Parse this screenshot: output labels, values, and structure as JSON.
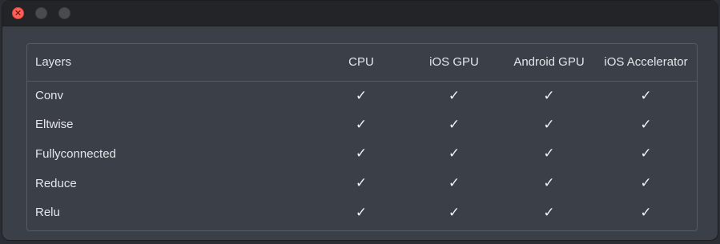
{
  "window": {
    "controls": {
      "close_glyph": "✕",
      "close_icon": "close-icon",
      "minimize_icon": "minimize-icon",
      "maximize_icon": "maximize-icon"
    }
  },
  "table": {
    "headers": [
      "Layers",
      "CPU",
      "iOS GPU",
      "Android GPU",
      "iOS Accelerator"
    ],
    "check_glyph": "✓",
    "rows": [
      {
        "layer": "Conv",
        "cells": [
          "✓",
          "✓",
          "✓",
          "✓"
        ]
      },
      {
        "layer": "Eltwise",
        "cells": [
          "✓",
          "✓",
          "✓",
          "✓"
        ]
      },
      {
        "layer": "Fullyconnected",
        "cells": [
          "✓",
          "✓",
          "✓",
          "✓"
        ]
      },
      {
        "layer": "Reduce",
        "cells": [
          "✓",
          "✓",
          "✓",
          "✓"
        ]
      },
      {
        "layer": "Relu",
        "cells": [
          "✓",
          "✓",
          "✓",
          "✓"
        ]
      }
    ]
  },
  "colors": {
    "window_bg": "#3a3f48",
    "titlebar_bg": "#232428",
    "close_red": "#fe5f57",
    "inactive_control": "#4a4b4f",
    "text": "#e4e6ea",
    "border": "#565c67"
  }
}
